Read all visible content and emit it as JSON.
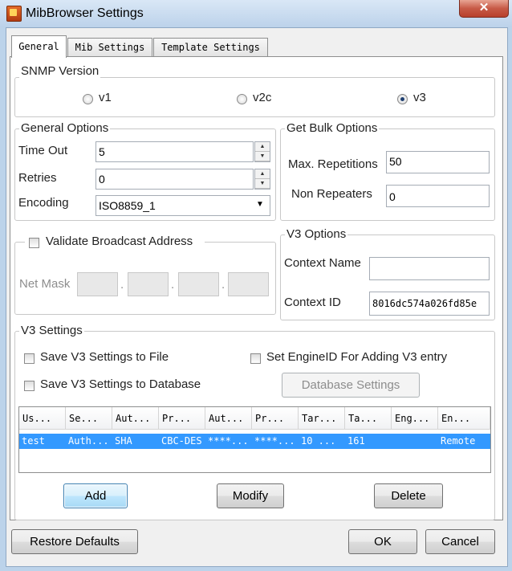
{
  "window": {
    "title": "MibBrowser Settings",
    "close_glyph": "✕",
    "icon": "app-icon"
  },
  "tabs": [
    {
      "label": "General",
      "active": true
    },
    {
      "label": "Mib Settings",
      "active": false
    },
    {
      "label": "Template Settings",
      "active": false
    }
  ],
  "snmp_version": {
    "legend": "SNMP Version",
    "options": [
      {
        "label": "v1",
        "selected": false
      },
      {
        "label": "v2c",
        "selected": false
      },
      {
        "label": "v3",
        "selected": true
      }
    ]
  },
  "general_options": {
    "legend": "General Options",
    "timeout_label": "Time Out",
    "timeout_value": "5",
    "retries_label": "Retries",
    "retries_value": "0",
    "encoding_label": "Encoding",
    "encoding_value": "ISO8859_1"
  },
  "get_bulk": {
    "legend": "Get Bulk Options",
    "max_rep_label": "Max. Repetitions",
    "max_rep_value": "50",
    "non_rep_label": "Non Repeaters",
    "non_rep_value": "0"
  },
  "broadcast": {
    "checkbox_label": "Validate Broadcast Address",
    "checked": false,
    "netmask_label": "Net Mask",
    "dot": "."
  },
  "v3_options": {
    "legend": "V3 Options",
    "context_name_label": "Context Name",
    "context_name_value": "",
    "context_id_label": "Context ID",
    "context_id_value": "8016dc574a026fd85e"
  },
  "v3_settings": {
    "legend": "V3 Settings",
    "save_file_label": "Save V3 Settings to File",
    "save_db_label": "Save V3 Settings to Database",
    "engine_id_label": "Set EngineID For Adding V3 entry",
    "db_settings_button": "Database Settings",
    "columns": [
      "Us...",
      "Se...",
      "Aut...",
      "Pr...",
      "Aut...",
      "Pr...",
      "Tar...",
      "Ta...",
      "Eng...",
      "En..."
    ],
    "rows": [
      [
        "test",
        "Auth...",
        "SHA",
        "CBC-DES",
        "****...",
        "****...",
        "10 ...",
        "161",
        "",
        "Remote"
      ]
    ],
    "add_button": "Add",
    "modify_button": "Modify",
    "delete_button": "Delete"
  },
  "footer": {
    "restore_button": "Restore Defaults",
    "ok_button": "OK",
    "cancel_button": "Cancel"
  }
}
